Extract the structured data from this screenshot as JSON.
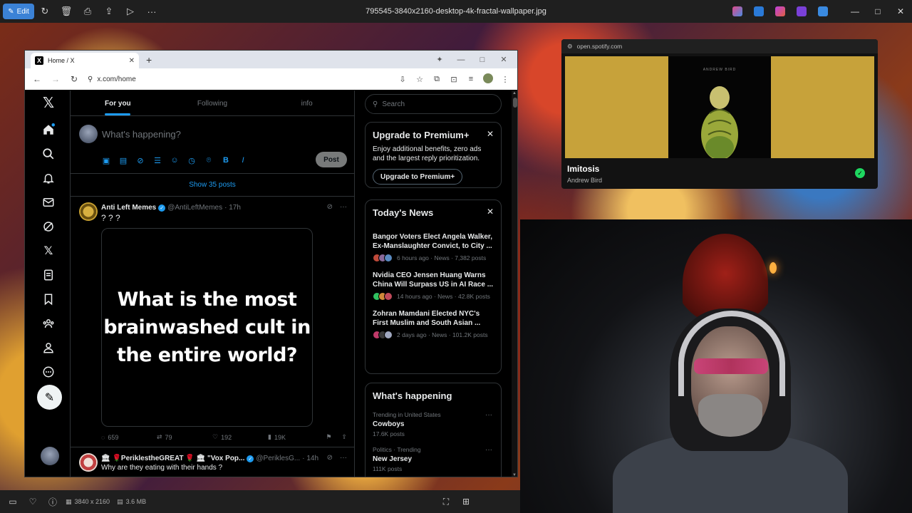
{
  "viewer": {
    "edit_label": "Edit",
    "filename": "795545-3840x2160-desktop-4k-fractal-wallpaper.jpg",
    "dimensions": "3840 x 2160",
    "filesize": "3.6 MB"
  },
  "browser": {
    "tab_title": "Home / X",
    "url": "x.com/home"
  },
  "x": {
    "tabs": [
      "For you",
      "Following",
      "info"
    ],
    "composer_placeholder": "What's happening?",
    "post_label": "Post",
    "show_posts": "Show 35 posts",
    "search_placeholder": "Search",
    "tweet1": {
      "name": "Anti Left Memes",
      "handle": "@AntiLeftMemes",
      "time": "· 17h",
      "text": "? ? ?",
      "media_text": "What is the most brainwashed cult in the entire world?",
      "replies": "659",
      "reposts": "79",
      "likes": "192",
      "views": "19K"
    },
    "tweet2": {
      "name": "🏛 🌹PeriklestheGREAT 🌹 🏛 \"Vox Pop...",
      "handle": "@PeriklesG...",
      "time": "· 14h",
      "text": "Why are they eating with their hands ?"
    },
    "premium": {
      "title": "Upgrade to Premium+",
      "desc": "Enjoy additional benefits, zero ads and the largest reply prioritization.",
      "button": "Upgrade to Premium+"
    },
    "news": {
      "title": "Today's News",
      "items": [
        {
          "title": "Bangor Voters Elect Angela Walker, Ex-Manslaughter Convict, to City ...",
          "meta": "6 hours ago · News · 7,382 posts"
        },
        {
          "title": "Nvidia CEO Jensen Huang Warns China Will Surpass US in AI Race ...",
          "meta": "14 hours ago · News · 42.8K posts"
        },
        {
          "title": "Zohran Mamdani Elected NYC's First Muslim and South Asian ...",
          "meta": "2 days ago · News · 101.2K posts"
        }
      ]
    },
    "happening": {
      "title": "What's happening",
      "items": [
        {
          "context": "Trending in United States",
          "name": "Cowboys",
          "count": "17.6K posts"
        },
        {
          "context": "Politics · Trending",
          "name": "New Jersey",
          "count": "111K posts"
        }
      ]
    }
  },
  "spotify": {
    "url": "open.spotify.com",
    "track": "Imitosis",
    "artist": "Andrew Bird",
    "cover_text": "ANDREW BIRD"
  }
}
